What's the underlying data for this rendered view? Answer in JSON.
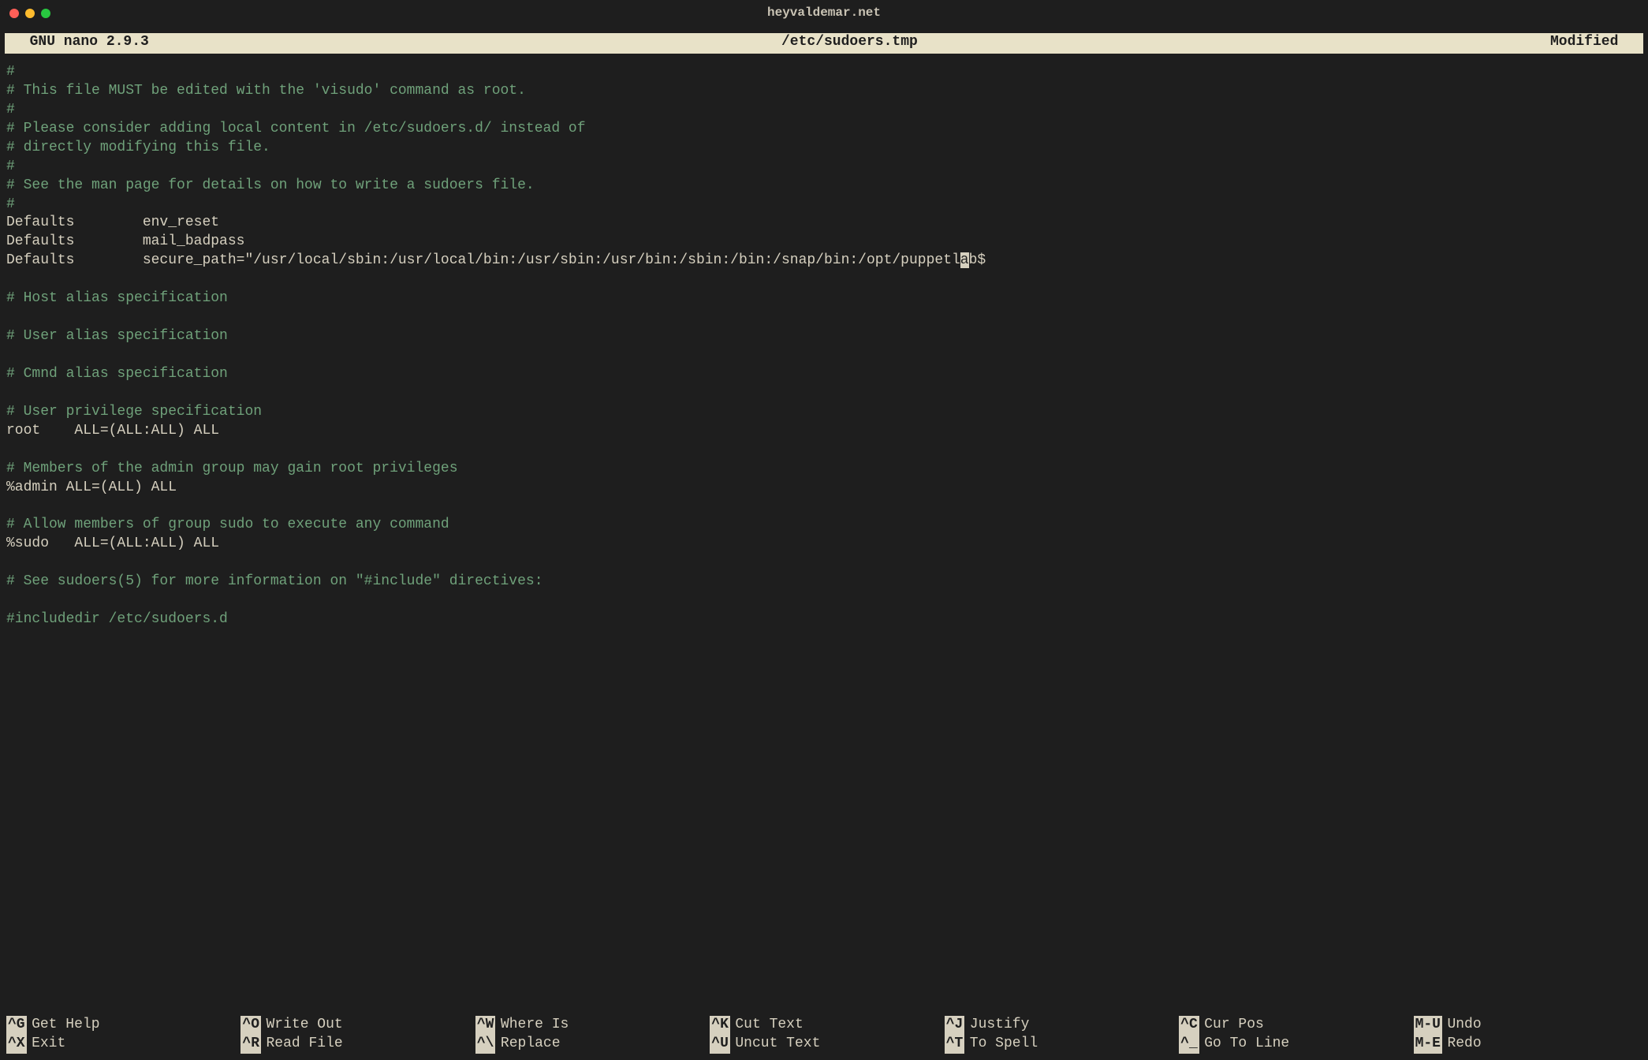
{
  "window": {
    "title": "heyvaldemar.net"
  },
  "nano_header": {
    "left": "  GNU nano 2.9.3",
    "file": "/etc/sudoers.tmp",
    "status": "Modified  "
  },
  "file": {
    "lines": [
      {
        "type": "comment",
        "text": "#"
      },
      {
        "type": "comment",
        "text": "# This file MUST be edited with the 'visudo' command as root."
      },
      {
        "type": "comment",
        "text": "#"
      },
      {
        "type": "comment",
        "text": "# Please consider adding local content in /etc/sudoers.d/ instead of"
      },
      {
        "type": "comment",
        "text": "# directly modifying this file."
      },
      {
        "type": "comment",
        "text": "#"
      },
      {
        "type": "comment",
        "text": "# See the man page for details on how to write a sudoers file."
      },
      {
        "type": "comment",
        "text": "#"
      },
      {
        "type": "plain",
        "text": "Defaults        env_reset"
      },
      {
        "type": "plain",
        "text": "Defaults        mail_badpass"
      },
      {
        "type": "plain-with-cursor",
        "before": "Defaults        secure_path=\"/usr/local/sbin:/usr/local/bin:/usr/sbin:/usr/bin:/sbin:/bin:/snap/bin:/opt/puppetl",
        "cursor": "a",
        "after": "b$"
      },
      {
        "type": "blank",
        "text": ""
      },
      {
        "type": "comment",
        "text": "# Host alias specification"
      },
      {
        "type": "blank",
        "text": ""
      },
      {
        "type": "comment",
        "text": "# User alias specification"
      },
      {
        "type": "blank",
        "text": ""
      },
      {
        "type": "comment",
        "text": "# Cmnd alias specification"
      },
      {
        "type": "blank",
        "text": ""
      },
      {
        "type": "comment",
        "text": "# User privilege specification"
      },
      {
        "type": "plain",
        "text": "root    ALL=(ALL:ALL) ALL"
      },
      {
        "type": "blank",
        "text": ""
      },
      {
        "type": "comment",
        "text": "# Members of the admin group may gain root privileges"
      },
      {
        "type": "plain",
        "text": "%admin ALL=(ALL) ALL"
      },
      {
        "type": "blank",
        "text": ""
      },
      {
        "type": "comment",
        "text": "# Allow members of group sudo to execute any command"
      },
      {
        "type": "plain",
        "text": "%sudo   ALL=(ALL:ALL) ALL"
      },
      {
        "type": "blank",
        "text": ""
      },
      {
        "type": "comment",
        "text": "# See sudoers(5) for more information on \"#include\" directives:"
      },
      {
        "type": "blank",
        "text": ""
      },
      {
        "type": "comment",
        "text": "#includedir /etc/sudoers.d"
      }
    ]
  },
  "shortcuts": {
    "row1": [
      {
        "key": "^G",
        "label": "Get Help"
      },
      {
        "key": "^O",
        "label": "Write Out"
      },
      {
        "key": "^W",
        "label": "Where Is"
      },
      {
        "key": "^K",
        "label": "Cut Text"
      },
      {
        "key": "^J",
        "label": "Justify"
      },
      {
        "key": "^C",
        "label": "Cur Pos"
      },
      {
        "key": "M-U",
        "label": "Undo",
        "alt": true
      }
    ],
    "row2": [
      {
        "key": "^X",
        "label": "Exit"
      },
      {
        "key": "^R",
        "label": "Read File"
      },
      {
        "key": "^\\",
        "label": "Replace"
      },
      {
        "key": "^U",
        "label": "Uncut Text"
      },
      {
        "key": "^T",
        "label": "To Spell"
      },
      {
        "key": "^_",
        "label": "Go To Line"
      },
      {
        "key": "M-E",
        "label": "Redo",
        "alt": true
      }
    ]
  }
}
